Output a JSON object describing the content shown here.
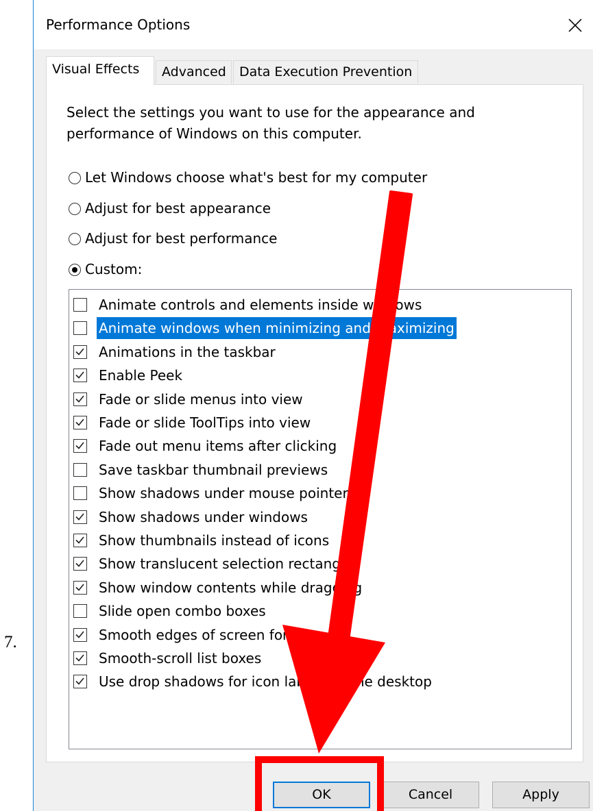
{
  "step_number": "7.",
  "window": {
    "title": "Performance Options",
    "close_icon": "close-icon"
  },
  "tabs": [
    {
      "label": "Visual Effects",
      "active": true
    },
    {
      "label": "Advanced",
      "active": false
    },
    {
      "label": "Data Execution Prevention",
      "active": false
    }
  ],
  "description": "Select the settings you want to use for the appearance and performance of Windows on this computer.",
  "radios": [
    {
      "label": "Let Windows choose what's best for my computer",
      "selected": false
    },
    {
      "label": "Adjust for best appearance",
      "selected": false
    },
    {
      "label": "Adjust for best performance",
      "selected": false
    },
    {
      "label": "Custom:",
      "selected": true
    }
  ],
  "options": [
    {
      "label": "Animate controls and elements inside windows",
      "checked": false,
      "highlighted": false
    },
    {
      "label": "Animate windows when minimizing and maximizing",
      "checked": false,
      "highlighted": true
    },
    {
      "label": "Animations in the taskbar",
      "checked": true,
      "highlighted": false
    },
    {
      "label": "Enable Peek",
      "checked": true,
      "highlighted": false
    },
    {
      "label": "Fade or slide menus into view",
      "checked": true,
      "highlighted": false
    },
    {
      "label": "Fade or slide ToolTips into view",
      "checked": true,
      "highlighted": false
    },
    {
      "label": "Fade out menu items after clicking",
      "checked": true,
      "highlighted": false
    },
    {
      "label": "Save taskbar thumbnail previews",
      "checked": false,
      "highlighted": false
    },
    {
      "label": "Show shadows under mouse pointer",
      "checked": false,
      "highlighted": false
    },
    {
      "label": "Show shadows under windows",
      "checked": true,
      "highlighted": false
    },
    {
      "label": "Show thumbnails instead of icons",
      "checked": true,
      "highlighted": false
    },
    {
      "label": "Show translucent selection rectangle",
      "checked": true,
      "highlighted": false
    },
    {
      "label": "Show window contents while dragging",
      "checked": true,
      "highlighted": false
    },
    {
      "label": "Slide open combo boxes",
      "checked": false,
      "highlighted": false
    },
    {
      "label": "Smooth edges of screen fonts",
      "checked": true,
      "highlighted": false
    },
    {
      "label": "Smooth-scroll list boxes",
      "checked": true,
      "highlighted": false
    },
    {
      "label": "Use drop shadows for icon labels on the desktop",
      "checked": true,
      "highlighted": false
    }
  ],
  "buttons": {
    "ok": "OK",
    "cancel": "Cancel",
    "apply": "Apply"
  },
  "colors": {
    "selection": "#0078d7",
    "annotation": "#ff0000"
  }
}
